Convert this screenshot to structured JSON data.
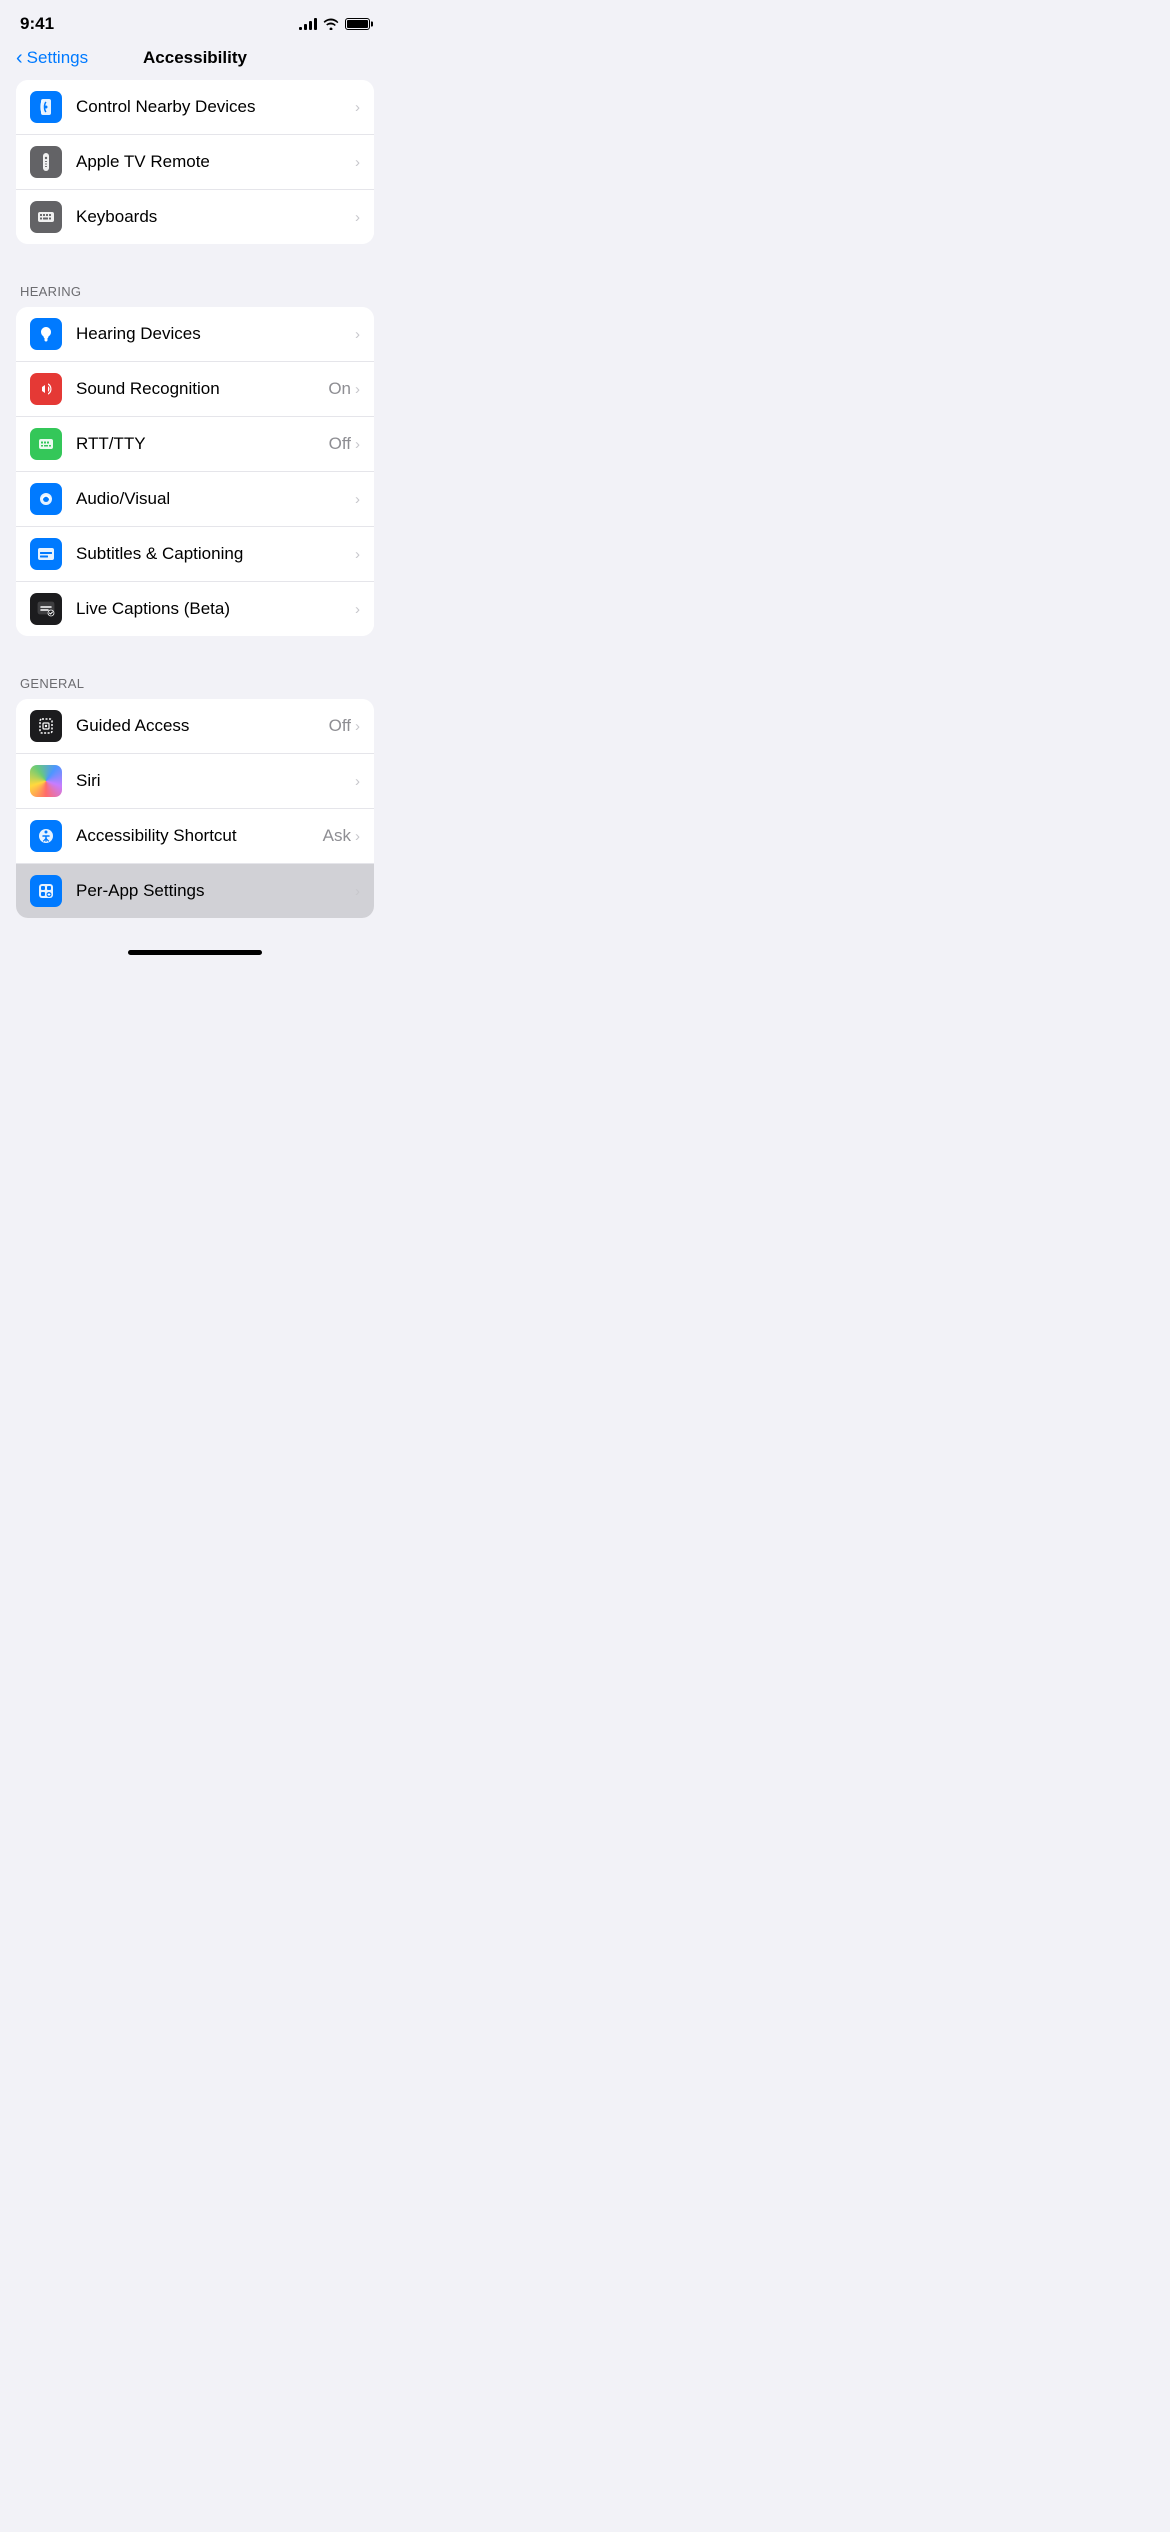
{
  "statusBar": {
    "time": "9:41",
    "signal": [
      3,
      6,
      9,
      12
    ],
    "battery": 100
  },
  "nav": {
    "backLabel": "Settings",
    "title": "Accessibility"
  },
  "partialGroup": {
    "items": [
      {
        "id": "control-nearby-devices",
        "label": "Control Nearby Devices",
        "iconBg": "#007aff",
        "iconType": "control-nearby",
        "value": "",
        "chevron": true
      },
      {
        "id": "apple-tv-remote",
        "label": "Apple TV Remote",
        "iconBg": "#636366",
        "iconType": "apple-tv-remote",
        "value": "",
        "chevron": true
      },
      {
        "id": "keyboards",
        "label": "Keyboards",
        "iconBg": "#636366",
        "iconType": "keyboard",
        "value": "",
        "chevron": true
      }
    ]
  },
  "sections": [
    {
      "id": "hearing",
      "header": "HEARING",
      "items": [
        {
          "id": "hearing-devices",
          "label": "Hearing Devices",
          "iconBg": "#007aff",
          "iconType": "hearing",
          "value": "",
          "chevron": true
        },
        {
          "id": "sound-recognition",
          "label": "Sound Recognition",
          "iconBg": "#e53935",
          "iconType": "sound-recognition",
          "value": "On",
          "chevron": true
        },
        {
          "id": "rtt-tty",
          "label": "RTT/TTY",
          "iconBg": "#34c759",
          "iconType": "rtt",
          "value": "Off",
          "chevron": true
        },
        {
          "id": "audio-visual",
          "label": "Audio/Visual",
          "iconBg": "#007aff",
          "iconType": "audio-visual",
          "value": "",
          "chevron": true
        },
        {
          "id": "subtitles-captioning",
          "label": "Subtitles & Captioning",
          "iconBg": "#007aff",
          "iconType": "subtitles",
          "value": "",
          "chevron": true
        },
        {
          "id": "live-captions",
          "label": "Live Captions (Beta)",
          "iconBg": "#1c1c1e",
          "iconType": "live-captions",
          "value": "",
          "chevron": true
        }
      ]
    },
    {
      "id": "general",
      "header": "GENERAL",
      "items": [
        {
          "id": "guided-access",
          "label": "Guided Access",
          "iconBg": "#1c1c1e",
          "iconType": "guided-access",
          "value": "Off",
          "chevron": true
        },
        {
          "id": "siri",
          "label": "Siri",
          "iconBg": "siri-gradient",
          "iconType": "siri",
          "value": "",
          "chevron": true
        },
        {
          "id": "accessibility-shortcut",
          "label": "Accessibility Shortcut",
          "iconBg": "#007aff",
          "iconType": "accessibility-shortcut",
          "value": "Ask",
          "chevron": true
        },
        {
          "id": "per-app-settings",
          "label": "Per-App Settings",
          "iconBg": "#007aff",
          "iconType": "per-app",
          "value": "",
          "chevron": true,
          "highlighted": true
        }
      ]
    }
  ]
}
